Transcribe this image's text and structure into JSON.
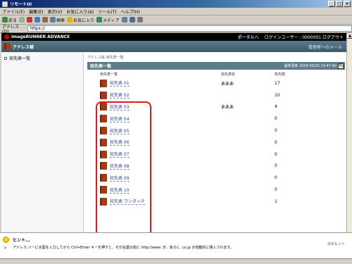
{
  "window": {
    "title": "リモートUI"
  },
  "menu": [
    "ファイル(F)",
    "編集(E)",
    "表示(V)",
    "お気に入り(A)",
    "ツール(T)",
    "ヘルプ(H)"
  ],
  "toolbar": {
    "back": "戻る",
    "search": "検索",
    "favorites": "お気に入り",
    "media": "メディア"
  },
  "address": {
    "label": "アドレス(D)",
    "value": "https://"
  },
  "header": {
    "brand": "imageRUNNER ADVANCE",
    "portal": "ポータルへ",
    "login": "ログインユーザー : 0000001 ログアウト"
  },
  "app": {
    "title": "アドレス帳",
    "manager": "管理者へのメール"
  },
  "sidebar": {
    "item": "宛先表一覧"
  },
  "breadcrumb": "アドレス帳  宛先表一覧",
  "list": {
    "title": "宛先表一覧",
    "updated": "最終更新  2009 09/20 10:47:40",
    "headers": [
      "宛先表一覧",
      "宛先表名",
      "宛先数"
    ],
    "rows": [
      {
        "name": "宛先表 01",
        "label": "あああ",
        "count": "17"
      },
      {
        "name": "宛先表 02",
        "label": "",
        "count": "10"
      },
      {
        "name": "宛先表 03",
        "label": "あああ",
        "count": "4"
      },
      {
        "name": "宛先表 04",
        "label": "",
        "count": "0"
      },
      {
        "name": "宛先表 05",
        "label": "",
        "count": "0"
      },
      {
        "name": "宛先表 06",
        "label": "",
        "count": "0"
      },
      {
        "name": "宛先表 07",
        "label": "",
        "count": "0"
      },
      {
        "name": "宛先表 08",
        "label": "",
        "count": "0"
      },
      {
        "name": "宛先表 09",
        "label": "",
        "count": "0"
      },
      {
        "name": "宛先表 10",
        "label": "",
        "count": "0"
      },
      {
        "name": "宛先表 ワンタッチ",
        "label": "",
        "count": "1"
      }
    ]
  },
  "hint": {
    "title": "ヒント...",
    "text": "アドレス バーに言葉を入力してから Ctrl+Enter キーを押すと、その言葉の前に http://www. が、後ろに .co.jp が自動的に挿入されます。",
    "next": "次のヒント"
  },
  "colors": {
    "annotation": "#e0191c",
    "header_bar": "#5e7b88",
    "link": "#2a3f9a"
  }
}
